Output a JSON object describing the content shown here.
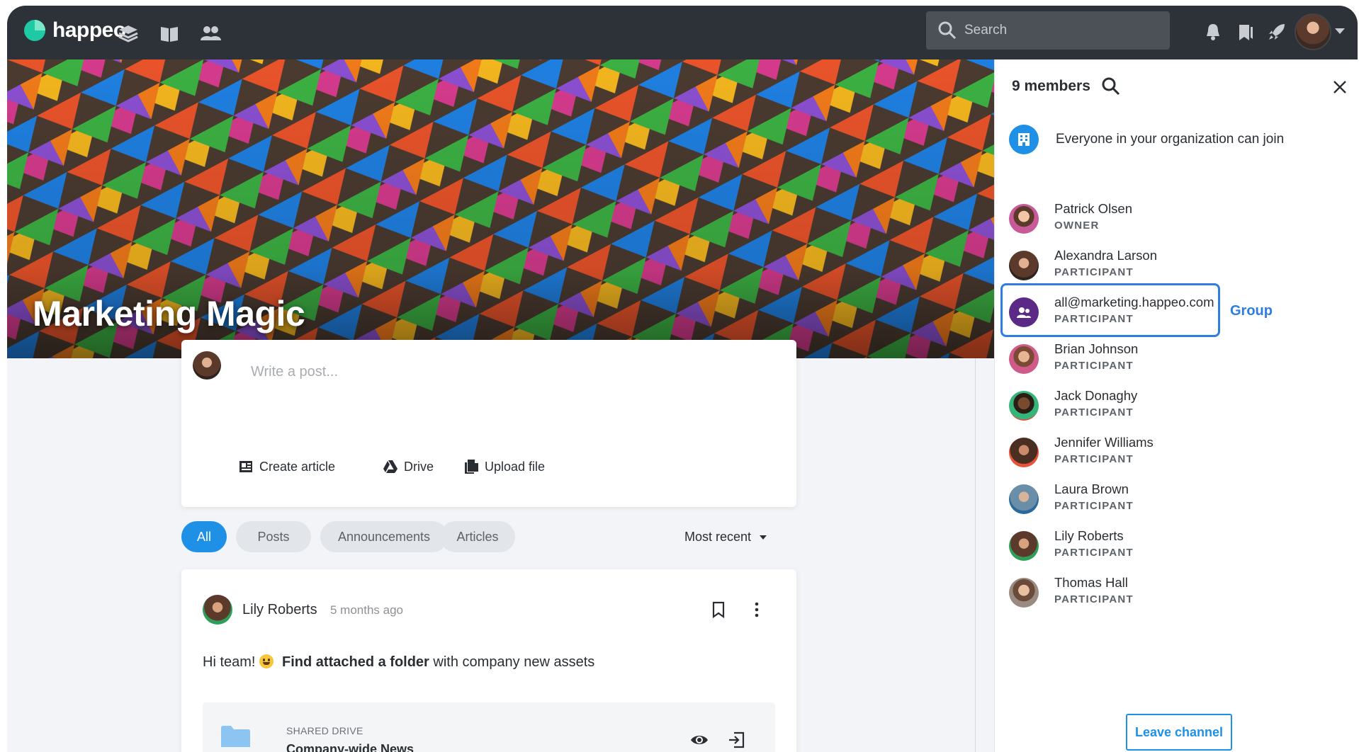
{
  "app": {
    "brand": "happeo",
    "nav_icons": [
      "layers-icon",
      "book-icon",
      "people-icon"
    ],
    "search_placeholder": "Search",
    "header_icons": [
      "bell-icon",
      "bookmarks-icon",
      "rocket-icon"
    ]
  },
  "channel": {
    "title": "Marketing Magic"
  },
  "composer": {
    "placeholder": "Write a post...",
    "actions": {
      "create_article": "Create article",
      "drive": "Drive",
      "upload_file": "Upload file"
    }
  },
  "filters": {
    "all": "All",
    "posts": "Posts",
    "announcements": "Announcements",
    "articles": "Articles",
    "sort": "Most recent"
  },
  "post": {
    "author": "Lily Roberts",
    "time": "5 months ago",
    "body_prefix": "Hi team!",
    "body_bold": "Find attached a folder",
    "body_suffix": "with company new assets",
    "attachment": {
      "kicker": "SHARED DRIVE",
      "title": "Company-wide News"
    }
  },
  "members_panel": {
    "title": "9 members",
    "org_note": "Everyone in your organization can join",
    "group_label": "Group",
    "leave_button": "Leave channel",
    "members": [
      {
        "name": "Patrick Olsen",
        "role": "OWNER"
      },
      {
        "name": "Alexandra Larson",
        "role": "PARTICIPANT"
      },
      {
        "name": "all@marketing.happeo.com",
        "role": "PARTICIPANT"
      },
      {
        "name": "Brian Johnson",
        "role": "PARTICIPANT"
      },
      {
        "name": "Jack Donaghy",
        "role": "PARTICIPANT"
      },
      {
        "name": "Jennifer Williams",
        "role": "PARTICIPANT"
      },
      {
        "name": "Laura Brown",
        "role": "PARTICIPANT"
      },
      {
        "name": "Lily Roberts",
        "role": "PARTICIPANT"
      },
      {
        "name": "Thomas Hall",
        "role": "PARTICIPANT"
      }
    ]
  },
  "colors": {
    "topbar": "#2d3138",
    "accent": "#1e90e6",
    "group_highlight": "#2f7de1",
    "brand_mark": "#1ec9a4"
  }
}
